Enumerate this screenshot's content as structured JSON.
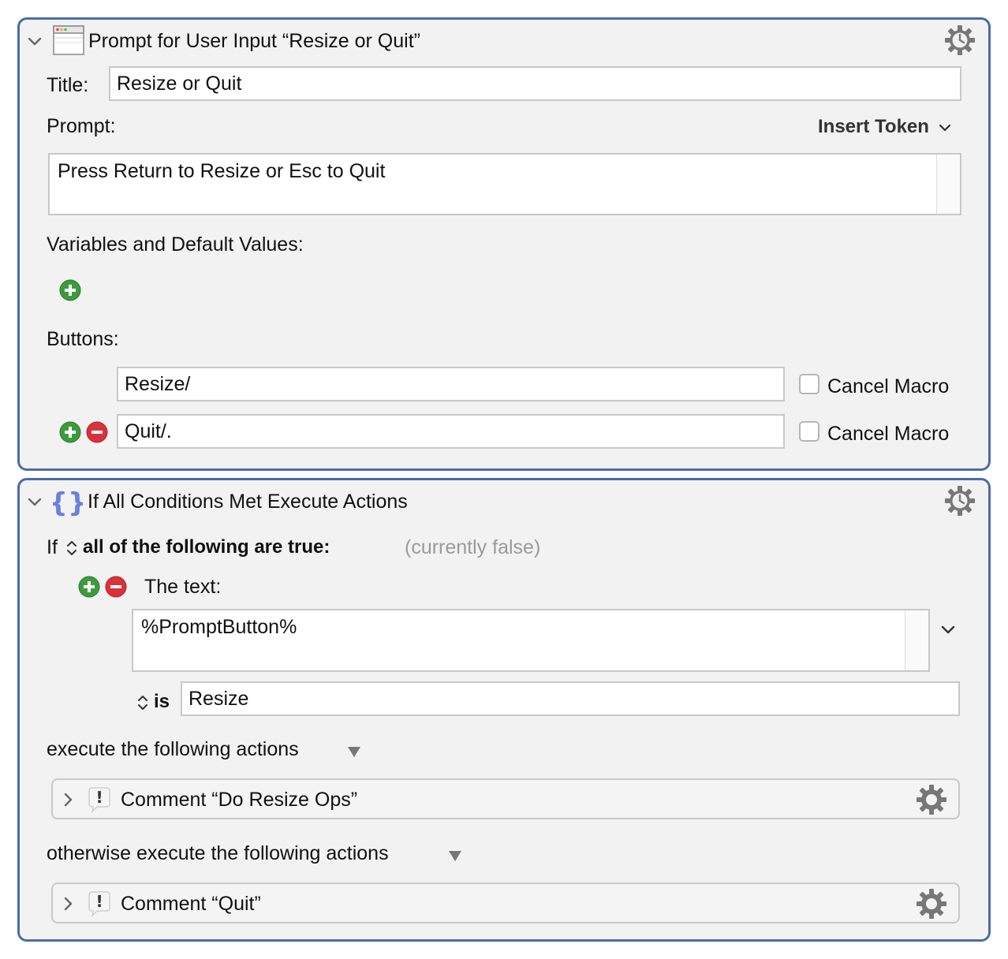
{
  "action1": {
    "title": "Prompt for User Input “Resize or Quit”",
    "title_label": "Title:",
    "title_value": "Resize or Quit",
    "prompt_label": "Prompt:",
    "insert_token": "Insert Token",
    "prompt_value": "Press Return to Resize or Esc to Quit",
    "variables_label": "Variables and Default Values:",
    "buttons_label": "Buttons:",
    "buttons": [
      {
        "value": "Resize/",
        "cancel_label": "Cancel Macro"
      },
      {
        "value": "Quit/.",
        "cancel_label": "Cancel Macro"
      }
    ]
  },
  "action2": {
    "title": "If All Conditions Met Execute Actions",
    "if_label": "If",
    "condition_mode": "all of the following are true:",
    "status": "(currently false)",
    "text_label": "The text:",
    "text_value": "%PromptButton%",
    "is_label": "is",
    "is_value": "Resize",
    "then_label": "execute the following actions",
    "then_action": "Comment “Do Resize Ops”",
    "else_label": "otherwise execute the following actions",
    "else_action": "Comment “Quit”"
  },
  "colors": {
    "panel_border": "#4a6da8",
    "add_green": "#3d9a3d",
    "remove_red": "#d8333b"
  }
}
